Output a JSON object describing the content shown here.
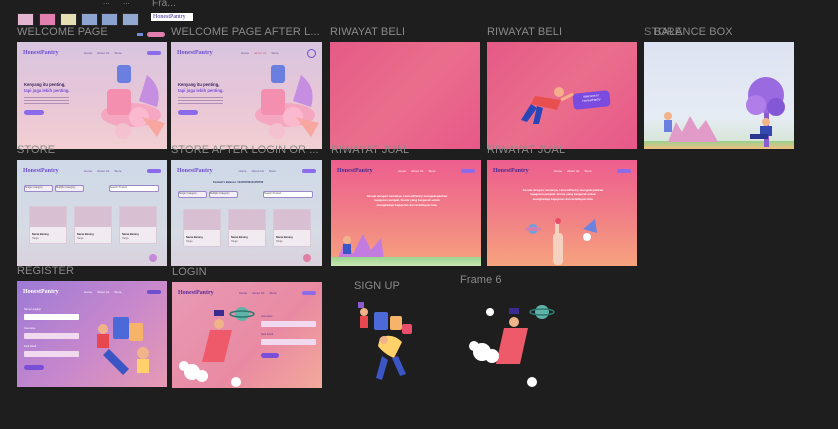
{
  "canvas": {
    "background": "#1e1e1e",
    "top_frame_label": "Fra...",
    "tiny_brand_preview": "HonestPantry",
    "tiny_dots_left": "...",
    "tiny_dots_right": "...",
    "palette": [
      "#e3b5cf",
      "#e37fae",
      "#e4e0b3",
      "#8ea6cf",
      "#8aa2cf",
      "#93a9d2"
    ]
  },
  "brand": "HonestPantry",
  "frames": {
    "welcome": {
      "label": "WELCOME PAGE"
    },
    "welcome_after_login": {
      "label": "WELCOME PAGE AFTER L..."
    },
    "riwayat_beli_1": {
      "label": "RIWAYAT BELI"
    },
    "riwayat_beli_2": {
      "label": "RIWAYAT BELI"
    },
    "balance_box": {
      "label": "BALANCE BOX",
      "overlap_label": "STORE"
    },
    "store": {
      "label": "STORE"
    },
    "store_after_login": {
      "label": "STORE AFTER LOGIN OR ..."
    },
    "riwayat_jual_1": {
      "label": "RIWAYAT JUAL"
    },
    "riwayat_jual_2": {
      "label": "RIWAYAT JUAL"
    },
    "register": {
      "label": "REGISTER"
    },
    "login": {
      "label": "LOGIN"
    },
    "sign_up": {
      "label": "SIGN UP"
    },
    "frame6": {
      "label": "Frame 6"
    }
  },
  "hero": {
    "title_line1": "Kenyang itu penting,",
    "title_line2": "tapi juga lebih penting.",
    "cta": "Get Started"
  },
  "store": {
    "filter1": "Single Category",
    "filter2": "Multiple Category",
    "search_placeholder": "Search Product",
    "cards": [
      {
        "name": "Image",
        "title": "Nama Barang",
        "price": "Harga"
      },
      {
        "name": "Image",
        "title": "Nama Barang",
        "price": "Harga"
      },
      {
        "name": "Image",
        "title": "Nama Barang",
        "price": "Harga"
      }
    ],
    "balance_line": "Pembeli's Balance: 123456789123456789"
  },
  "riwayat_beli": {
    "badge_line1": "Welcome to",
    "badge_line2": "HonestPantry"
  },
  "riwayat_jual": {
    "text": "Sesuai dengan namanya, HonestPantry mengedepankan kejujuran penjual, bisnis yang bergerak untuk menghadapi kejujuran dan kehidupan kita."
  },
  "register": {
    "fields": [
      "Nama Lengkap",
      "Username",
      "Kata Sandi",
      "Konfirmasi Kata Sandi"
    ],
    "button": "Daftar"
  },
  "login": {
    "fields": [
      "Username",
      "Kata Sandi"
    ],
    "button": "Masuk"
  },
  "nav": {
    "links": [
      "Home",
      "About Us",
      "Store"
    ],
    "login": "Login",
    "signup": "Sign Up"
  }
}
